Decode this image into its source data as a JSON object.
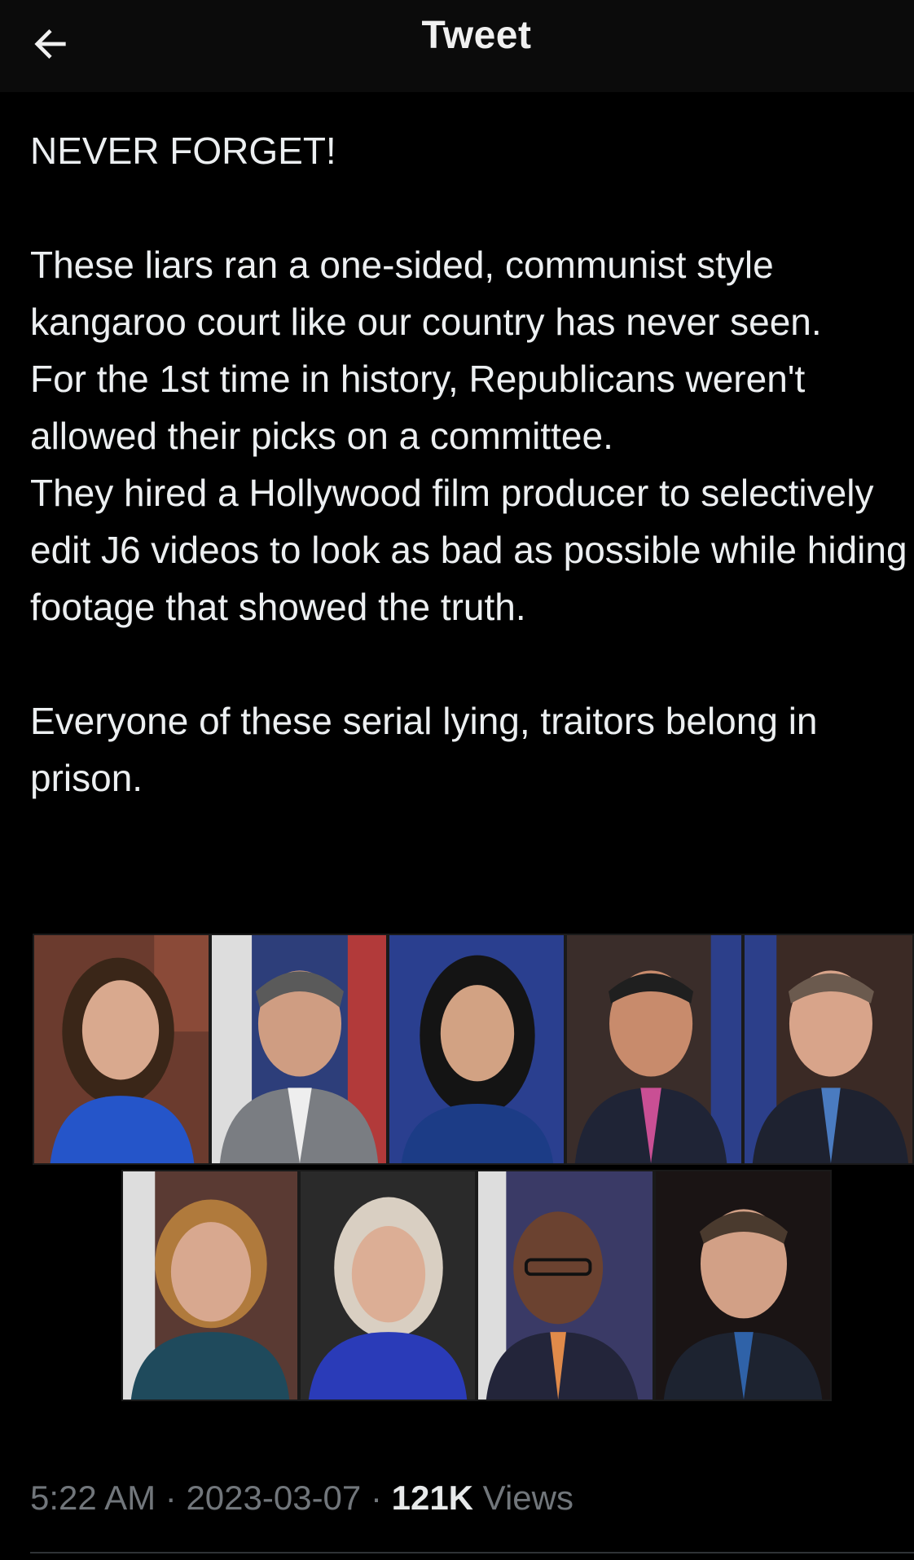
{
  "header": {
    "title": "Tweet",
    "back_icon": "arrow-left-icon"
  },
  "tweet": {
    "paragraph_1": "NEVER FORGET!",
    "paragraph_2": "These liars ran a one-sided, communist style kangaroo court like our country has never seen.\nFor the 1st time in history, Republicans weren't allowed their picks on a committee.\nThey hired a Hollywood film producer to selectively edit J6 videos to look as bad as possible while hiding footage that showed the truth.",
    "paragraph_3": "Everyone of these serial lying, traitors belong in prison."
  },
  "meta": {
    "time": "5:22 AM",
    "sep1": " · ",
    "date": "2023-03-07",
    "sep2": " · ",
    "views_count": "121K",
    "views_label": " Views"
  },
  "colors": {
    "background": "#000000",
    "header_bg": "#0b0b0b",
    "text": "#e7e9ea",
    "secondary_text": "#71767b"
  }
}
